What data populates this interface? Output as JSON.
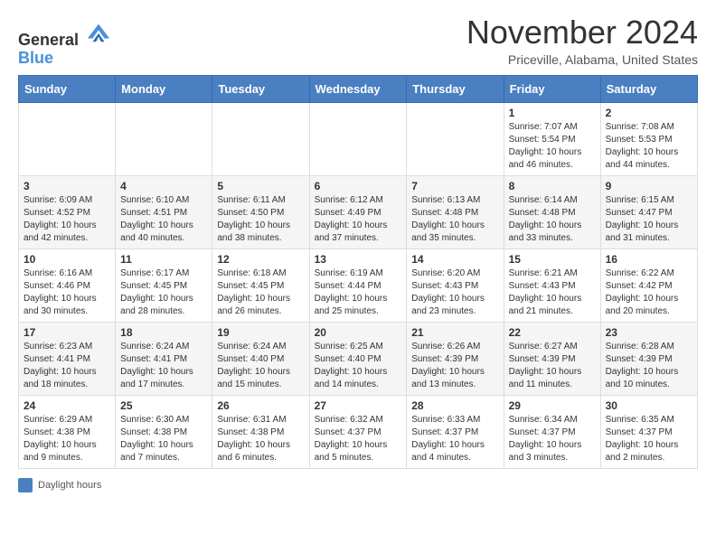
{
  "header": {
    "logo_line1": "General",
    "logo_line2": "Blue",
    "month": "November 2024",
    "location": "Priceville, Alabama, United States"
  },
  "legend": {
    "label": "Daylight hours"
  },
  "days_of_week": [
    "Sunday",
    "Monday",
    "Tuesday",
    "Wednesday",
    "Thursday",
    "Friday",
    "Saturday"
  ],
  "weeks": [
    [
      {
        "num": "",
        "info": ""
      },
      {
        "num": "",
        "info": ""
      },
      {
        "num": "",
        "info": ""
      },
      {
        "num": "",
        "info": ""
      },
      {
        "num": "",
        "info": ""
      },
      {
        "num": "1",
        "info": "Sunrise: 7:07 AM\nSunset: 5:54 PM\nDaylight: 10 hours and 46 minutes."
      },
      {
        "num": "2",
        "info": "Sunrise: 7:08 AM\nSunset: 5:53 PM\nDaylight: 10 hours and 44 minutes."
      }
    ],
    [
      {
        "num": "3",
        "info": "Sunrise: 6:09 AM\nSunset: 4:52 PM\nDaylight: 10 hours and 42 minutes."
      },
      {
        "num": "4",
        "info": "Sunrise: 6:10 AM\nSunset: 4:51 PM\nDaylight: 10 hours and 40 minutes."
      },
      {
        "num": "5",
        "info": "Sunrise: 6:11 AM\nSunset: 4:50 PM\nDaylight: 10 hours and 38 minutes."
      },
      {
        "num": "6",
        "info": "Sunrise: 6:12 AM\nSunset: 4:49 PM\nDaylight: 10 hours and 37 minutes."
      },
      {
        "num": "7",
        "info": "Sunrise: 6:13 AM\nSunset: 4:48 PM\nDaylight: 10 hours and 35 minutes."
      },
      {
        "num": "8",
        "info": "Sunrise: 6:14 AM\nSunset: 4:48 PM\nDaylight: 10 hours and 33 minutes."
      },
      {
        "num": "9",
        "info": "Sunrise: 6:15 AM\nSunset: 4:47 PM\nDaylight: 10 hours and 31 minutes."
      }
    ],
    [
      {
        "num": "10",
        "info": "Sunrise: 6:16 AM\nSunset: 4:46 PM\nDaylight: 10 hours and 30 minutes."
      },
      {
        "num": "11",
        "info": "Sunrise: 6:17 AM\nSunset: 4:45 PM\nDaylight: 10 hours and 28 minutes."
      },
      {
        "num": "12",
        "info": "Sunrise: 6:18 AM\nSunset: 4:45 PM\nDaylight: 10 hours and 26 minutes."
      },
      {
        "num": "13",
        "info": "Sunrise: 6:19 AM\nSunset: 4:44 PM\nDaylight: 10 hours and 25 minutes."
      },
      {
        "num": "14",
        "info": "Sunrise: 6:20 AM\nSunset: 4:43 PM\nDaylight: 10 hours and 23 minutes."
      },
      {
        "num": "15",
        "info": "Sunrise: 6:21 AM\nSunset: 4:43 PM\nDaylight: 10 hours and 21 minutes."
      },
      {
        "num": "16",
        "info": "Sunrise: 6:22 AM\nSunset: 4:42 PM\nDaylight: 10 hours and 20 minutes."
      }
    ],
    [
      {
        "num": "17",
        "info": "Sunrise: 6:23 AM\nSunset: 4:41 PM\nDaylight: 10 hours and 18 minutes."
      },
      {
        "num": "18",
        "info": "Sunrise: 6:24 AM\nSunset: 4:41 PM\nDaylight: 10 hours and 17 minutes."
      },
      {
        "num": "19",
        "info": "Sunrise: 6:24 AM\nSunset: 4:40 PM\nDaylight: 10 hours and 15 minutes."
      },
      {
        "num": "20",
        "info": "Sunrise: 6:25 AM\nSunset: 4:40 PM\nDaylight: 10 hours and 14 minutes."
      },
      {
        "num": "21",
        "info": "Sunrise: 6:26 AM\nSunset: 4:39 PM\nDaylight: 10 hours and 13 minutes."
      },
      {
        "num": "22",
        "info": "Sunrise: 6:27 AM\nSunset: 4:39 PM\nDaylight: 10 hours and 11 minutes."
      },
      {
        "num": "23",
        "info": "Sunrise: 6:28 AM\nSunset: 4:39 PM\nDaylight: 10 hours and 10 minutes."
      }
    ],
    [
      {
        "num": "24",
        "info": "Sunrise: 6:29 AM\nSunset: 4:38 PM\nDaylight: 10 hours and 9 minutes."
      },
      {
        "num": "25",
        "info": "Sunrise: 6:30 AM\nSunset: 4:38 PM\nDaylight: 10 hours and 7 minutes."
      },
      {
        "num": "26",
        "info": "Sunrise: 6:31 AM\nSunset: 4:38 PM\nDaylight: 10 hours and 6 minutes."
      },
      {
        "num": "27",
        "info": "Sunrise: 6:32 AM\nSunset: 4:37 PM\nDaylight: 10 hours and 5 minutes."
      },
      {
        "num": "28",
        "info": "Sunrise: 6:33 AM\nSunset: 4:37 PM\nDaylight: 10 hours and 4 minutes."
      },
      {
        "num": "29",
        "info": "Sunrise: 6:34 AM\nSunset: 4:37 PM\nDaylight: 10 hours and 3 minutes."
      },
      {
        "num": "30",
        "info": "Sunrise: 6:35 AM\nSunset: 4:37 PM\nDaylight: 10 hours and 2 minutes."
      }
    ]
  ]
}
